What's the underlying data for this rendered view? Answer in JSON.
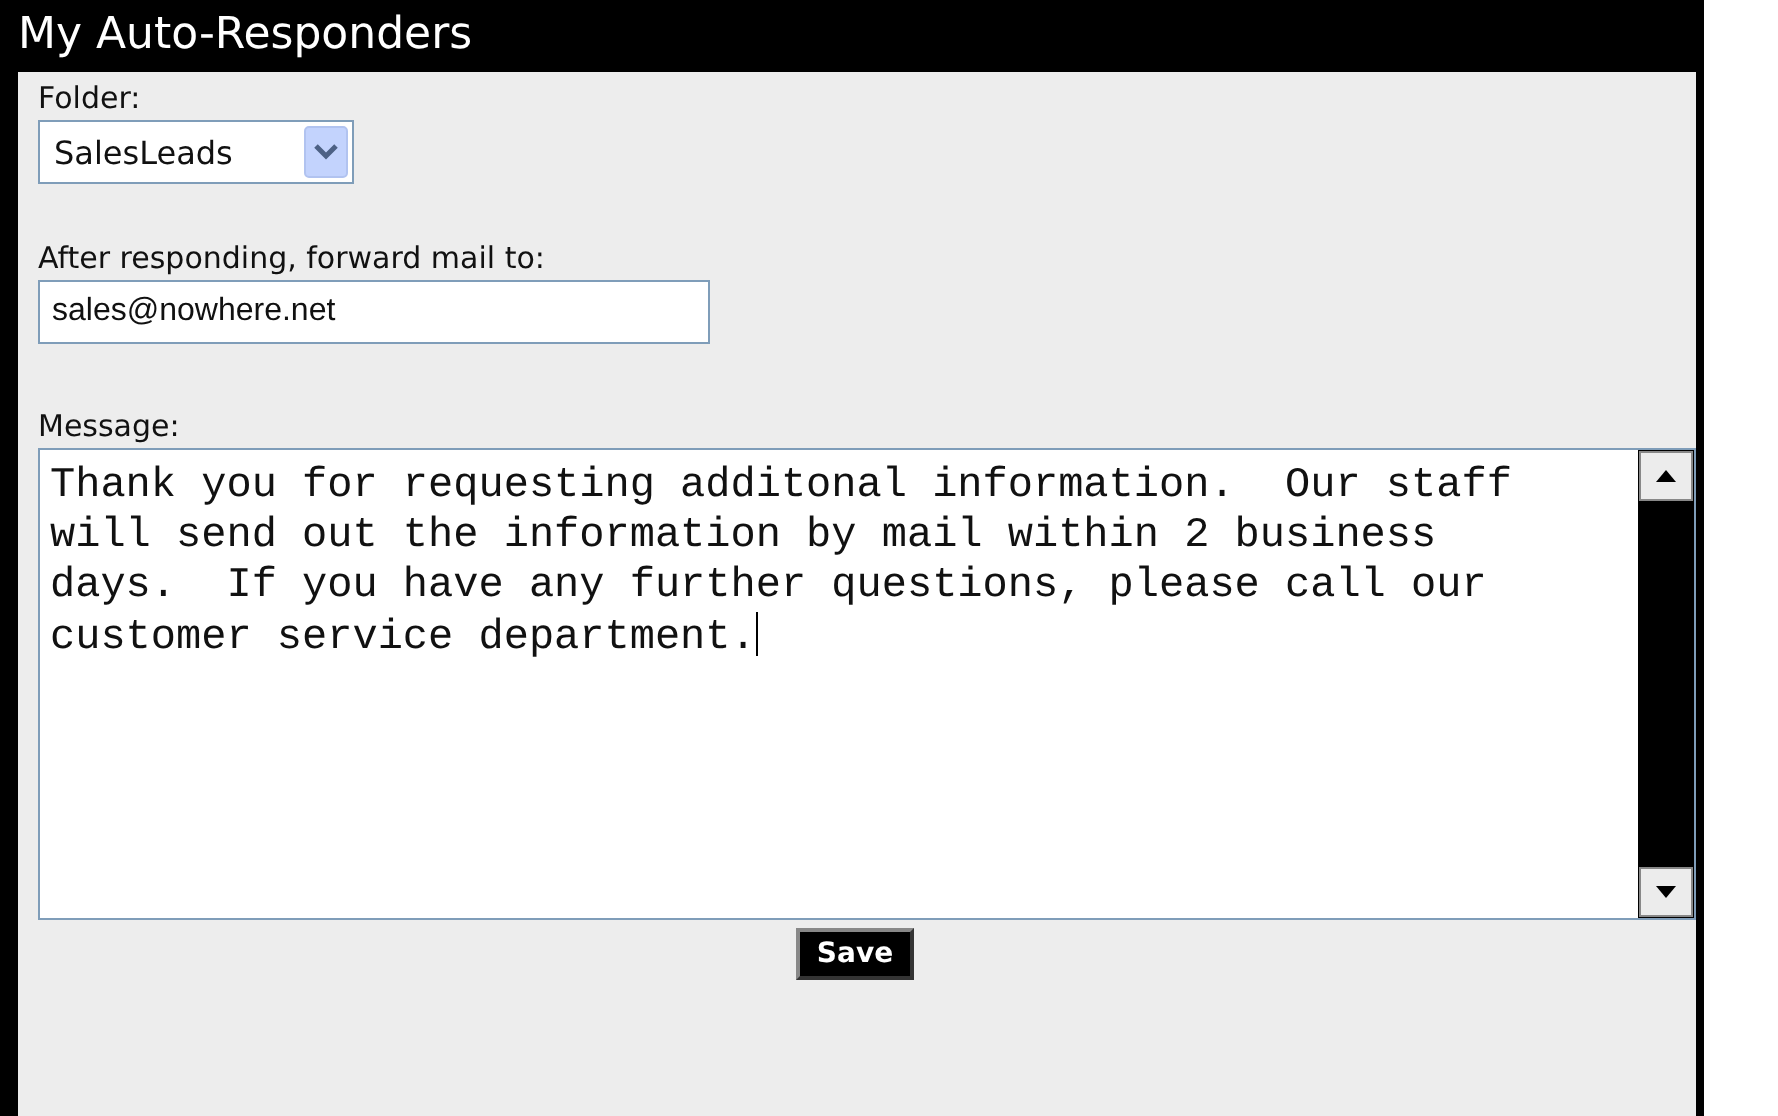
{
  "title": "My Auto-Responders",
  "folder": {
    "label": "Folder:",
    "value": "SalesLeads"
  },
  "forward": {
    "label": "After responding, forward mail to:",
    "value": "sales@nowhere.net"
  },
  "message": {
    "label": "Message:",
    "value": "Thank you for requesting additonal information.  Our staff will send out the information by mail within 2 business days.  If you have any further questions, please call our customer service department."
  },
  "save_button": "Save"
}
